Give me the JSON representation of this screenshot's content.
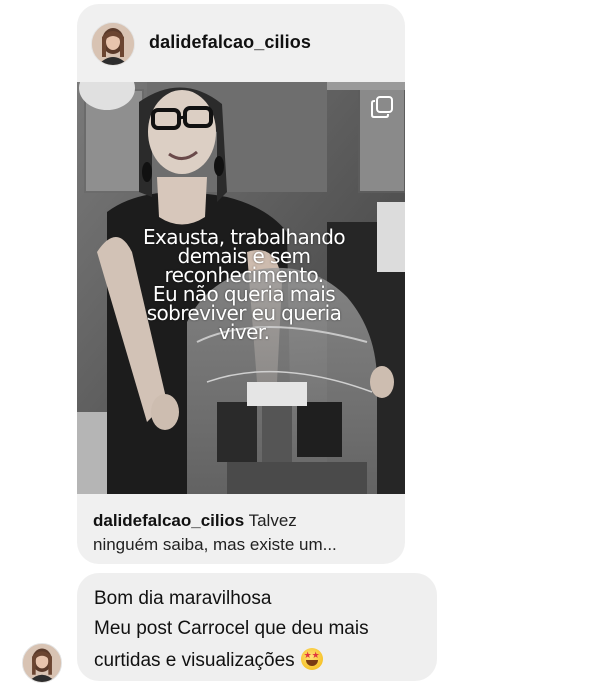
{
  "shared_post": {
    "username": "dalidefalcao_cilios",
    "overlay_text": [
      "Exausta, trabalhando",
      "demais e sem",
      "reconhecimento.",
      "Eu não queria mais",
      "sobreviver eu queria",
      "viver."
    ],
    "caption_username": "dalidefalcao_cilios",
    "caption_text_line1": " Talvez",
    "caption_text_line2": "ninguém saiba, mas existe um..."
  },
  "reply_message": {
    "lines": [
      "Bom dia maravilhosa",
      "Meu post Carrocel que deu mais",
      "curtidas e visualizações"
    ],
    "emoji": "star-struck-emoji"
  },
  "icons": {
    "multi_image_indicator": "carousel-icon"
  }
}
